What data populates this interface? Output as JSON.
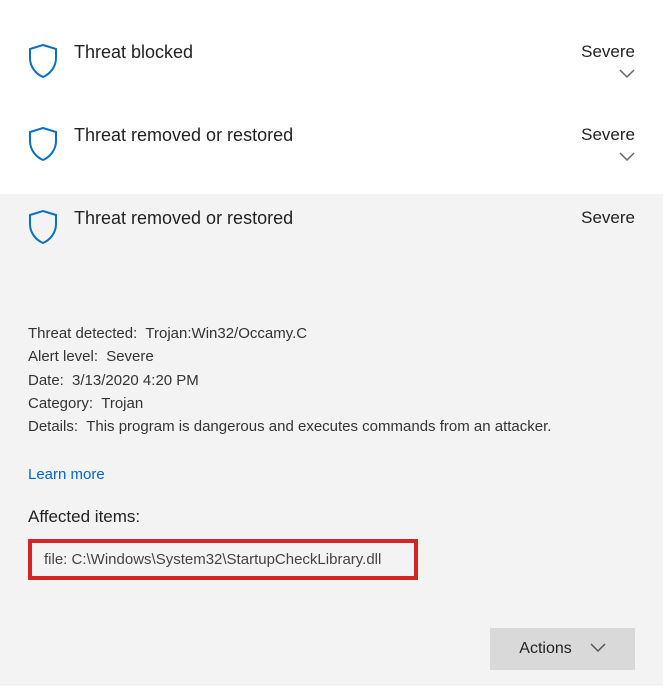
{
  "threats": [
    {
      "title": "Threat blocked",
      "severity": "Severe"
    },
    {
      "title": "Threat removed or restored",
      "severity": "Severe"
    },
    {
      "title": "Threat removed or restored",
      "severity": "Severe"
    }
  ],
  "details": {
    "threat_detected_label": "Threat detected:",
    "threat_detected_value": "Trojan:Win32/Occamy.C",
    "alert_level_label": "Alert level:",
    "alert_level_value": "Severe",
    "date_label": "Date:",
    "date_value": "3/13/2020 4:20 PM",
    "category_label": "Category:",
    "category_value": "Trojan",
    "details_label": "Details:",
    "details_value": "This program is dangerous and executes commands from an attacker."
  },
  "learn_more": "Learn more",
  "affected_heading": "Affected items:",
  "affected_item": "file: C:\\Windows\\System32\\StartupCheckLibrary.dll",
  "actions_label": "Actions"
}
